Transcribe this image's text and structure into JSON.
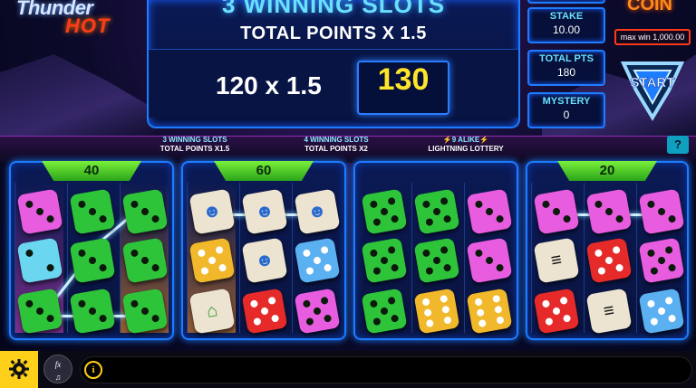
{
  "logo": {
    "line1": "Thunder",
    "line2": "HOT"
  },
  "banner": {
    "title": "3 WINNING SLOTS",
    "subtitle": "TOTAL POINTS X 1.5"
  },
  "calculation": {
    "expression": "120 x 1.5",
    "result": "130"
  },
  "info": {
    "stake_label": "STAKE",
    "stake_value": "10.00",
    "total_label": "TOTAL PTS",
    "total_value": "180",
    "mystery_label": "MYSTERY",
    "mystery_value": "0"
  },
  "coin_label": "COIN",
  "max_win": "max win 1,000.00",
  "start_label": "START",
  "multipliers": [
    {
      "line1": "3 WINNING SLOTS",
      "line2": "TOTAL POINTS X1.5"
    },
    {
      "line1": "4 WINNING SLOTS",
      "line2": "TOTAL POINTS X2"
    },
    {
      "line1": "⚡9 ALIKE⚡",
      "line2": "LIGHTNING LOTTERY"
    }
  ],
  "help_label": "?",
  "reels": [
    {
      "pay": "40"
    },
    {
      "pay": "60"
    },
    {
      "pay": ""
    },
    {
      "pay": "20"
    }
  ],
  "colors": {
    "accent": "#1e7cff",
    "pay_green": "#4cd62a",
    "result_yellow": "#ffe52a",
    "gear_yellow": "#ffd01a"
  },
  "icons": [
    "gear-icon",
    "fx-sound-icon",
    "info-icon"
  ],
  "fx_label": "fx"
}
